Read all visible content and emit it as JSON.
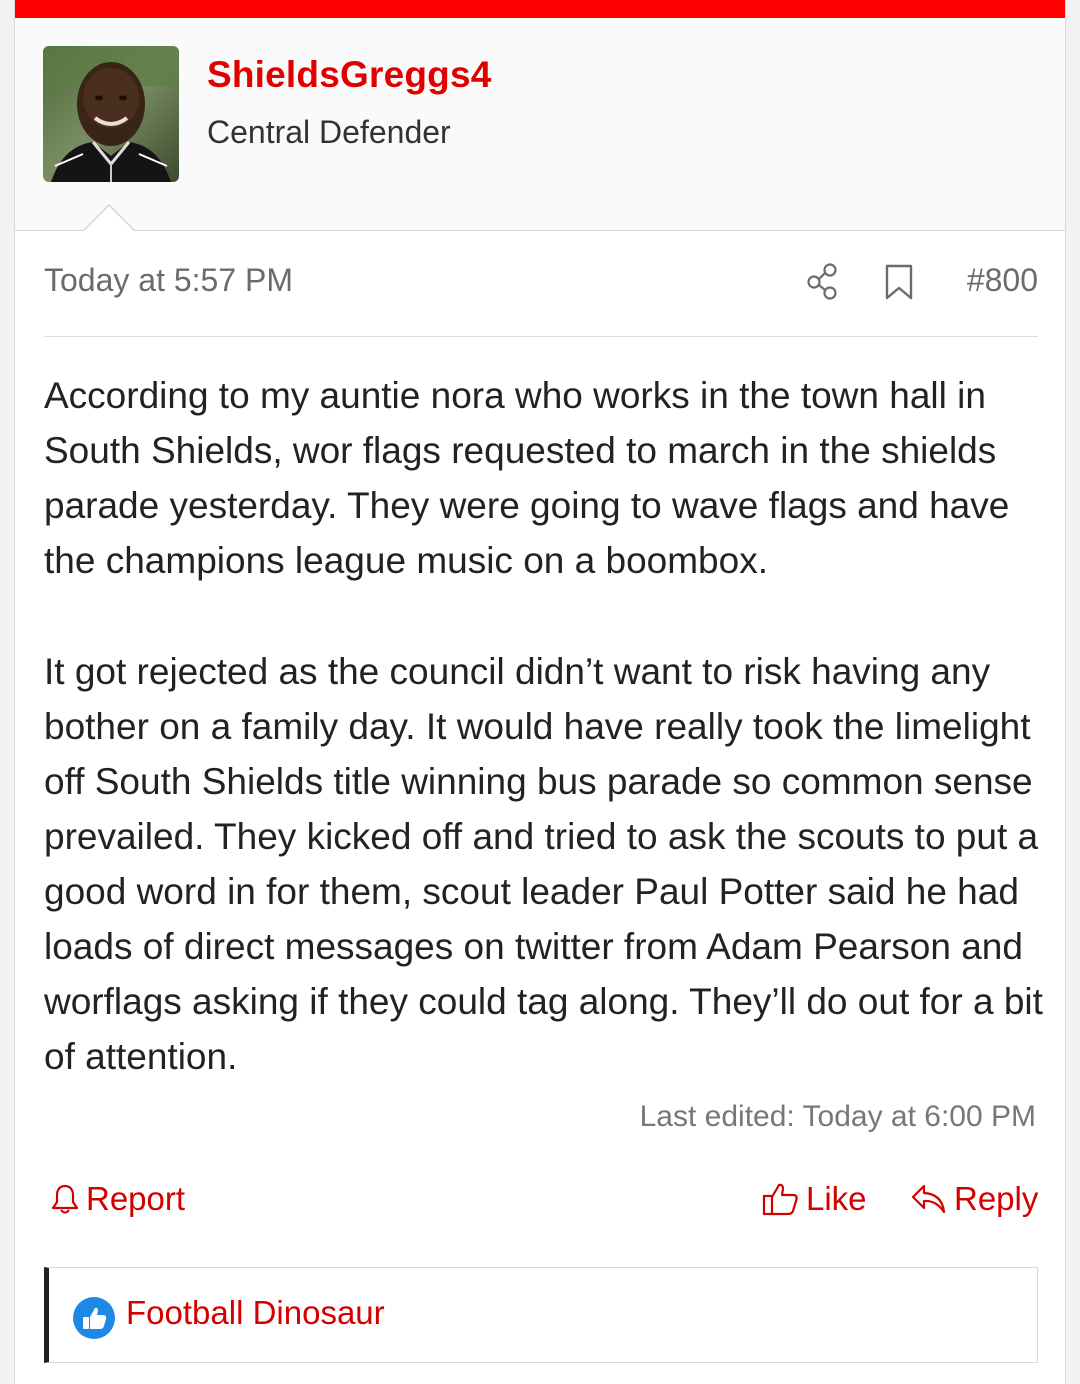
{
  "user": {
    "name": "ShieldsGreggs4",
    "title": "Central Defender",
    "avatar_icon": "user-avatar-photo"
  },
  "post": {
    "date": "Today at 5:57 PM",
    "number": "#800",
    "share_icon": "share-icon",
    "bookmark_icon": "bookmark-icon",
    "paragraphs": [
      "According to my auntie nora who works in the town hall in South Shields, wor flags requested to march in the shields parade yesterday. They were going to wave flags and have the champions league music on a boombox.",
      "It got rejected as the council didn’t want to risk having any bother on a family day. It would have really took the limelight off South Shields title winning bus parade so common sense prevailed. They kicked off and tried to ask the scouts to put a good word in for them, scout leader Paul Potter said he had loads of direct messages on twitter from Adam Pearson and worflags asking if they could tag along. They’ll do out for a bit of attention."
    ],
    "last_edited": "Last edited: Today at 6:00 PM"
  },
  "actions": {
    "report": "Report",
    "like": "Like",
    "reply": "Reply"
  },
  "reactions": {
    "users": "Football Dinosaur",
    "icon": "thumbs-up-reaction-icon"
  },
  "colors": {
    "accent": "#e00000",
    "top_bar": "#ff0000",
    "reaction_blue": "#1e88e5"
  }
}
